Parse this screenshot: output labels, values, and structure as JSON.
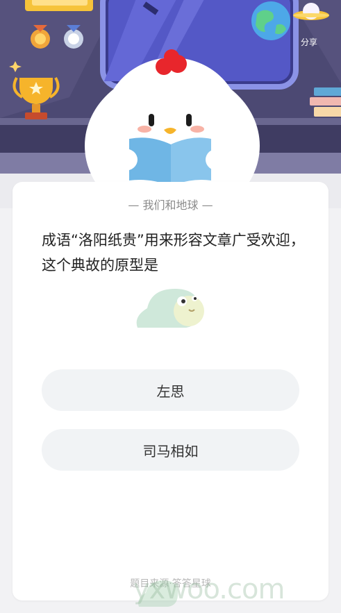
{
  "header": {
    "share_label": "分享"
  },
  "question_card": {
    "category": "— 我们和地球 —",
    "question_text": "成语“洛阳纸贵”用来形容文章广受欢迎，这个典故的原型是",
    "options": [
      {
        "label": "左思"
      },
      {
        "label": "司马相如"
      }
    ],
    "source": "题目来源·答答星球"
  },
  "watermark": {
    "text": "yxwoo.com"
  },
  "colors": {
    "background": "#f2f2f4",
    "card": "#ffffff",
    "option_bg": "#f1f3f5",
    "scene_wall": "#4a4770",
    "chicken_comb": "#e8262c",
    "book": "#6fb6e5"
  }
}
